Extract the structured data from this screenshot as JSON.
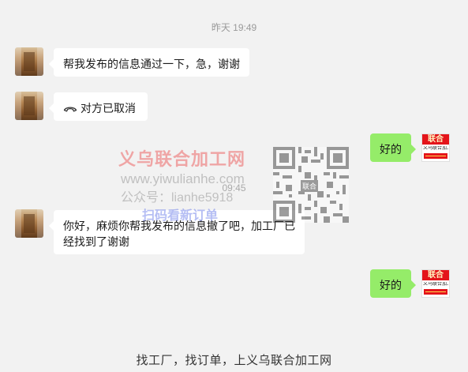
{
  "chat": {
    "timestamps": {
      "yesterday": "昨天 19:49",
      "mid": "09:45"
    },
    "messages": [
      {
        "side": "left",
        "text": "帮我发布的信息通过一下，急，谢谢"
      },
      {
        "side": "left",
        "icon": "hangup-phone-icon",
        "text": "对方已取消"
      },
      {
        "side": "right",
        "text": "好的"
      },
      {
        "side": "left",
        "text": "你好，麻烦你帮我发布的信息撤了吧，加工厂已经找到了谢谢"
      },
      {
        "side": "right",
        "text": "好的"
      }
    ],
    "right_avatar": {
      "label": "联合",
      "sub": "义乌联合加工网"
    }
  },
  "watermark": {
    "title": "义乌联合加工网",
    "url": "www.yiwulianhe.com",
    "account": "公众号：lianhe5918",
    "scan": "扫码看新订单",
    "qr_label": "联合"
  },
  "footer": {
    "text": "找工厂，找订单，上义乌联合加工网"
  },
  "colors": {
    "background": "#f2f2f2",
    "bubble_left": "#ffffff",
    "bubble_right": "#95ec69",
    "watermark_red": "#ec4646"
  }
}
